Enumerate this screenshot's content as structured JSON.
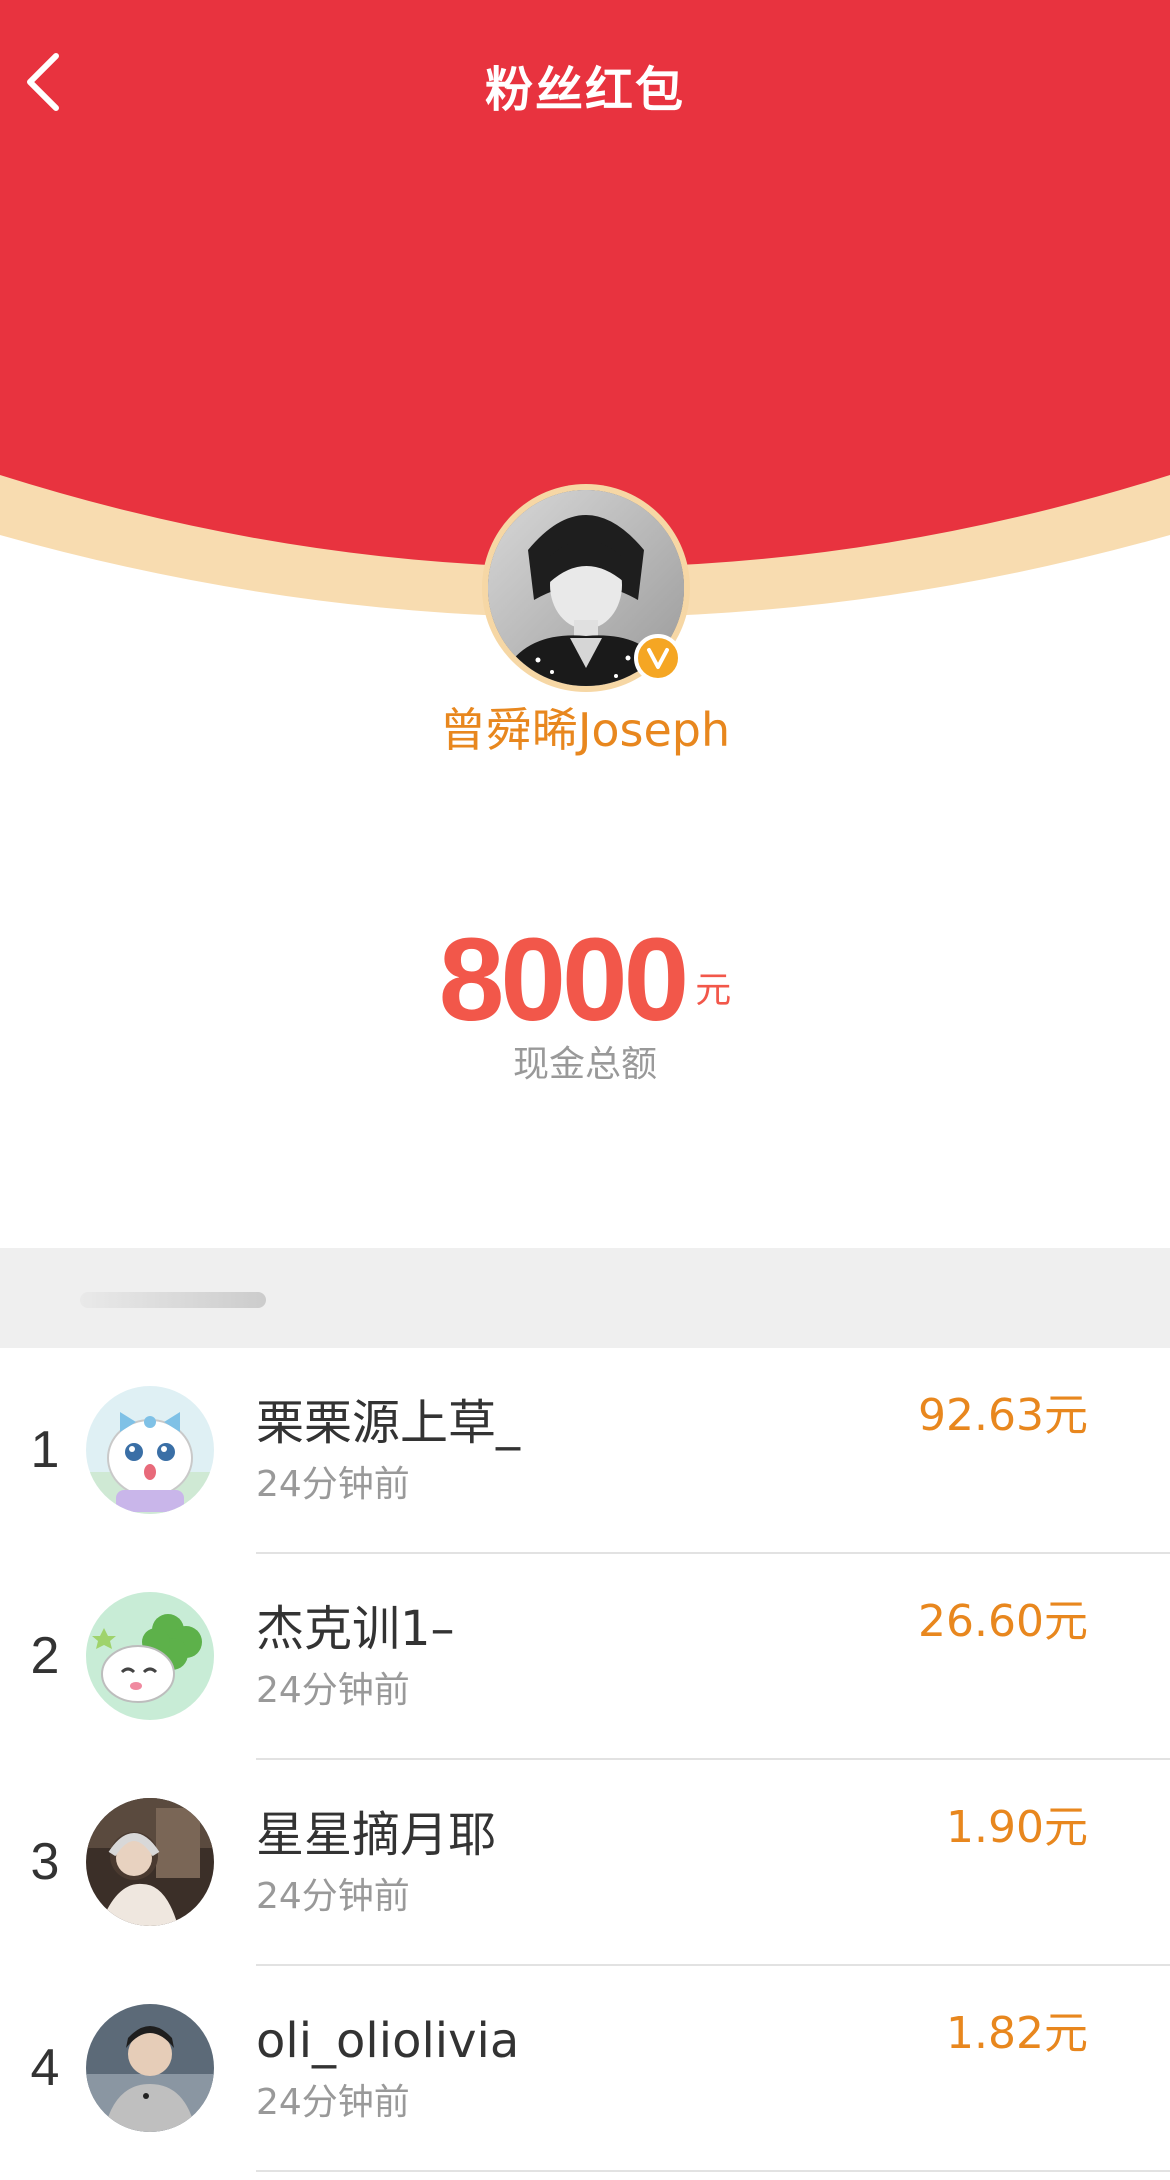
{
  "header": {
    "title": "粉丝红包",
    "back_icon": "chevron-left-icon"
  },
  "colors": {
    "hero_red": "#e8333f",
    "accent_orange": "#e8871e",
    "amount_red": "#f2574a",
    "cream": "#f6d7a5"
  },
  "sender": {
    "name": "曾舜晞Joseph",
    "verified_icon": "verified-v-icon"
  },
  "summary": {
    "amount": "8000",
    "unit": "元",
    "label": "现金总额"
  },
  "recipients": [
    {
      "rank": "1",
      "name": "栗栗源上草_",
      "time": "24分钟前",
      "amount": "92.63元"
    },
    {
      "rank": "2",
      "name": "杰克训1–",
      "time": "24分钟前",
      "amount": "26.60元"
    },
    {
      "rank": "3",
      "name": "星星摘月耶",
      "time": "24分钟前",
      "amount": "1.90元"
    },
    {
      "rank": "4",
      "name": "oli_oliolivia",
      "time": "24分钟前",
      "amount": "1.82元"
    }
  ]
}
